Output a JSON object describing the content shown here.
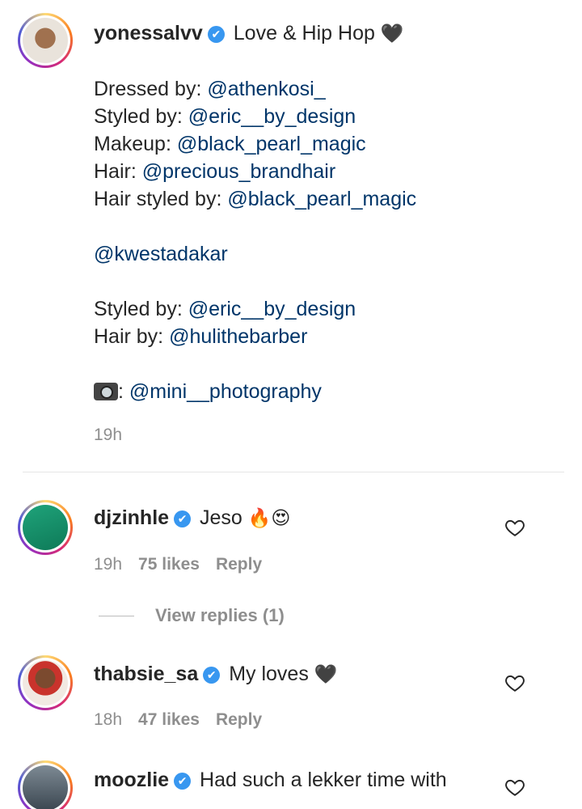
{
  "post": {
    "username": "yonessalvv",
    "verified_mark": "✔",
    "title": "Love & Hip Hop",
    "heart_emoji": "🖤",
    "credits": [
      {
        "label": "Dressed by: ",
        "handle": "@athenkosi_"
      },
      {
        "label": "Styled by: ",
        "handle": "@eric__by_design"
      },
      {
        "label": "Makeup: ",
        "handle": "@black_pearl_magic"
      },
      {
        "label": "Hair: ",
        "handle": "@precious_brandhair"
      },
      {
        "label": "Hair styled by: ",
        "handle": "@black_pearl_magic"
      }
    ],
    "mention": "@kwestadakar",
    "credits2": [
      {
        "label": "Styled by: ",
        "handle": "@eric__by_design"
      },
      {
        "label": "Hair by: ",
        "handle": "@hulithebarber"
      }
    ],
    "photo_sep": ": ",
    "photo_handle": "@mini__photography",
    "time": "19h"
  },
  "comments": [
    {
      "username": "djzinhle",
      "text": "Jeso",
      "emoji": "🔥😍",
      "time": "19h",
      "likes": "75 likes",
      "reply": "Reply"
    },
    {
      "username": "thabsie_sa",
      "text": "My loves",
      "emoji": "🖤",
      "time": "18h",
      "likes": "47 likes",
      "reply": "Reply"
    },
    {
      "username": "moozlie",
      "text": "Had such a lekker time with",
      "emoji": ""
    }
  ],
  "view_replies": "View replies (1)",
  "icons": {
    "like": "heart-outline-icon",
    "verified": "verified-badge-icon",
    "camera": "camera-flash-icon"
  },
  "colors": {
    "link": "#003569",
    "muted": "#8e8e8e",
    "verified": "#3897f0",
    "text": "#262626"
  }
}
